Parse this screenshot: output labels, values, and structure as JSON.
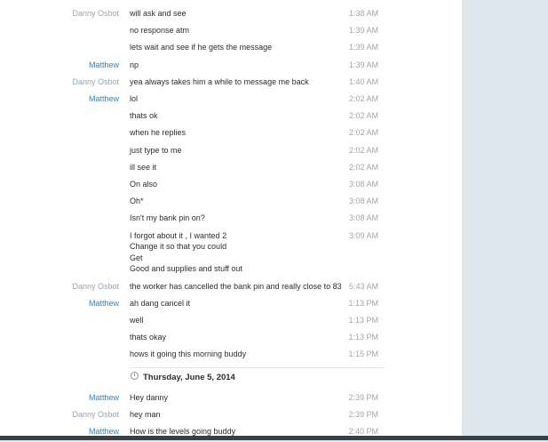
{
  "messages_before": [
    {
      "sender": "Danny Osbot",
      "role": "other",
      "text": [
        "will ask and see"
      ],
      "time": "1:38 AM"
    },
    {
      "sender": "",
      "role": "other",
      "text": [
        "no response atm"
      ],
      "time": "1:39 AM"
    },
    {
      "sender": "",
      "role": "other",
      "text": [
        "lets wait and see if he gets the message"
      ],
      "time": "1:39 AM"
    },
    {
      "sender": "Matthew",
      "role": "self",
      "text": [
        "np"
      ],
      "time": "1:39 AM"
    },
    {
      "sender": "Danny Osbot",
      "role": "other",
      "text": [
        "yea always takes him a while to message me back"
      ],
      "time": "1:40 AM"
    },
    {
      "sender": "Matthew",
      "role": "self",
      "text": [
        "lol"
      ],
      "time": "2:02 AM"
    },
    {
      "sender": "",
      "role": "self",
      "text": [
        "thats ok"
      ],
      "time": "2:02 AM"
    },
    {
      "sender": "",
      "role": "self",
      "text": [
        "when he replies"
      ],
      "time": "2:02 AM"
    },
    {
      "sender": "",
      "role": "self",
      "text": [
        "just type to me"
      ],
      "time": "2:02 AM"
    },
    {
      "sender": "",
      "role": "self",
      "text": [
        "ill see it"
      ],
      "time": "2:02 AM"
    },
    {
      "sender": "",
      "role": "self",
      "text": [
        "On also"
      ],
      "time": "3:08 AM"
    },
    {
      "sender": "",
      "role": "self",
      "text": [
        "Oh*"
      ],
      "time": "3:08 AM"
    },
    {
      "sender": "",
      "role": "self",
      "text": [
        "Isn't my bank pin on?"
      ],
      "time": "3:08 AM"
    },
    {
      "sender": "",
      "role": "self",
      "text": [
        "I forgot about it , I wanted 2",
        "Change it so that you could",
        "Get",
        "Good and supplies and stuff out"
      ],
      "time": "3:09 AM"
    },
    {
      "sender": "Danny Osbot",
      "role": "other",
      "text": [
        "the worker has cancelled the bank pin and really close to 83"
      ],
      "time": "5:43 AM"
    },
    {
      "sender": "Matthew",
      "role": "self",
      "text": [
        "ah dang cancel it"
      ],
      "time": "1:13 PM"
    },
    {
      "sender": "",
      "role": "self",
      "text": [
        "well"
      ],
      "time": "1:13 PM"
    },
    {
      "sender": "",
      "role": "self",
      "text": [
        "thats okay"
      ],
      "time": "1:13 PM"
    },
    {
      "sender": "",
      "role": "self",
      "text": [
        "hows it going this morning buddy"
      ],
      "time": "1:15 PM"
    }
  ],
  "date_separator": "Thursday, June 5, 2014",
  "messages_after": [
    {
      "sender": "Matthew",
      "role": "self",
      "text": [
        "Hey danny"
      ],
      "time": "2:39 PM"
    },
    {
      "sender": "Danny Osbot",
      "role": "other",
      "text": [
        "hey man"
      ],
      "time": "2:39 PM"
    },
    {
      "sender": "Matthew",
      "role": "self",
      "text": [
        "How is the levels going buddy"
      ],
      "time": "2:40 PM"
    }
  ]
}
